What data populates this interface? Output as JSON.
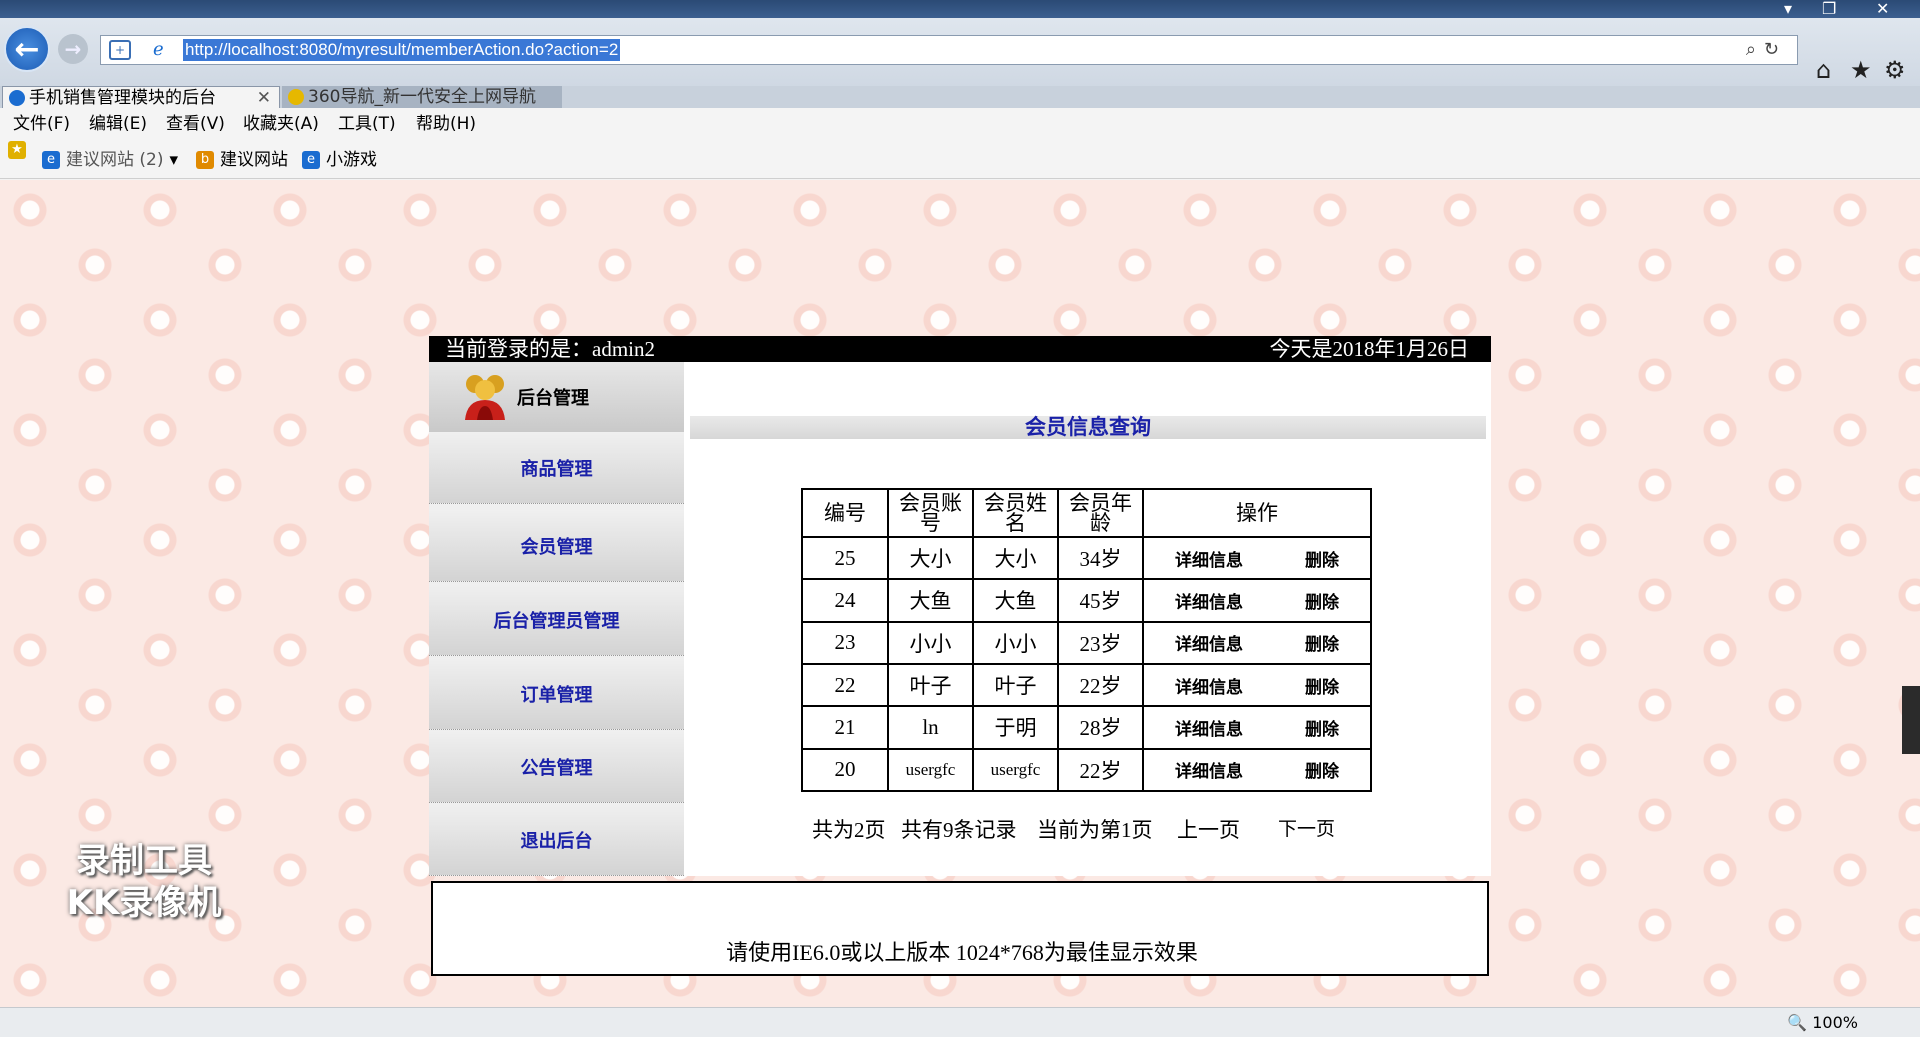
{
  "browser": {
    "url": "http://localhost:8080/myresult/memberAction.do?action=2",
    "tabs": [
      {
        "label": "手机销售管理模块的后台"
      },
      {
        "label": "360导航_新一代安全上网导航"
      }
    ],
    "menu": [
      "文件(F)",
      "编辑(E)",
      "查看(V)",
      "收藏夹(A)",
      "工具(T)",
      "帮助(H)"
    ],
    "favorites": [
      "建议网站 (2)",
      "建议网站",
      "小游戏"
    ],
    "zoom": "100%"
  },
  "page": {
    "login_text": "当前登录的是：admin2",
    "date_text": "今天是2018年1月26日",
    "sidebar": {
      "title": "后台管理",
      "items": [
        "商品管理",
        "会员管理",
        "后台管理员管理",
        "订单管理",
        "公告管理",
        "退出后台"
      ]
    },
    "main_title": "会员信息查询",
    "table": {
      "headers": [
        "编号",
        "会员账号",
        "会员姓名",
        "会员年龄",
        "操作"
      ],
      "rows": [
        {
          "id": "25",
          "account": "大小",
          "name": "大小",
          "age": "34岁",
          "detail": "详细信息",
          "delete": "删除"
        },
        {
          "id": "24",
          "account": "大鱼",
          "name": "大鱼",
          "age": "45岁",
          "detail": "详细信息",
          "delete": "删除"
        },
        {
          "id": "23",
          "account": "小小",
          "name": "小小",
          "age": "23岁",
          "detail": "详细信息",
          "delete": "删除"
        },
        {
          "id": "22",
          "account": "叶子",
          "name": "叶子",
          "age": "22岁",
          "detail": "详细信息",
          "delete": "删除"
        },
        {
          "id": "21",
          "account": "ln",
          "name": "于明",
          "age": "28岁",
          "detail": "详细信息",
          "delete": "删除"
        },
        {
          "id": "20",
          "account": "usergfc",
          "name": "usergfc",
          "age": "22岁",
          "detail": "详细信息",
          "delete": "删除"
        }
      ]
    },
    "pager": {
      "total_pages": "共为2页",
      "total_records": "共有9条记录",
      "current": "当前为第1页",
      "prev": "上一页",
      "next": "下一页"
    },
    "footer": "请使用IE6.0或以上版本 1024*768为最佳显示效果"
  },
  "watermark": {
    "line1": "录制工具",
    "line2": "KK录像机"
  },
  "colors": {
    "link": "#1a21a8",
    "topbar": "#000000",
    "background": "#fbe9e4"
  }
}
